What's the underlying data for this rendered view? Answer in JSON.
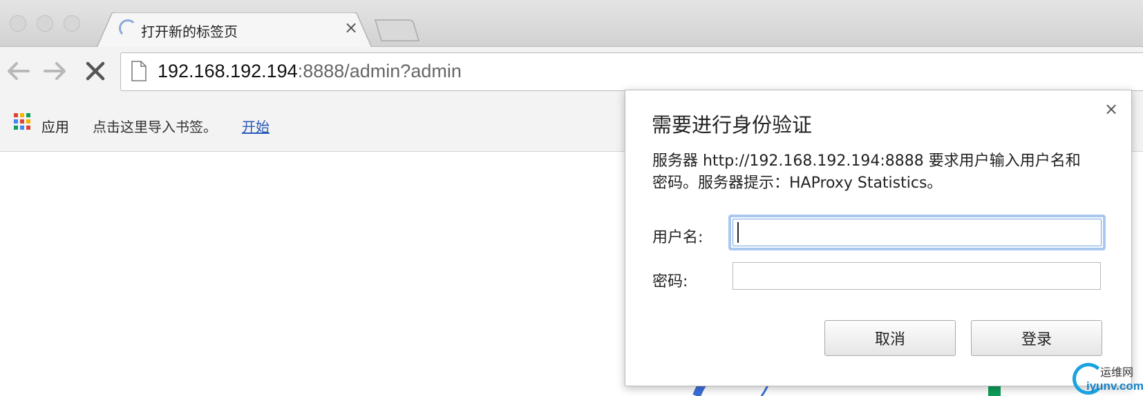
{
  "tab": {
    "title": "打开新的标签页",
    "close_glyph": "×"
  },
  "address_bar": {
    "host": "192.168.192.194",
    "rest": ":8888/admin?admin"
  },
  "bookmarks_bar": {
    "apps_label": "应用",
    "import_hint": "点击这里导入书签。",
    "start_link": "开始"
  },
  "auth_dialog": {
    "title": "需要进行身份验证",
    "close_glyph": "×",
    "message_line1": "服务器 http://192.168.192.194:8888 要求用户输入用户名和",
    "message_line2": "密码。服务器提示：HAProxy Statistics。",
    "username_label": "用户名:",
    "username_value": "",
    "password_label": "密码:",
    "password_value": "",
    "cancel_label": "取消",
    "login_label": "登录"
  },
  "watermark": {
    "cn": "运维网",
    "en": "iyunv.com"
  },
  "icons": {
    "back": "arrow-left-icon",
    "forward": "arrow-right-icon",
    "stop": "close-icon",
    "page": "page-icon",
    "apps": "apps-grid-icon",
    "spinner": "loading-spinner-icon"
  },
  "colors": {
    "link": "#2a5ab8",
    "focus_ring": "#a9c8ef",
    "apps_grid": [
      "#db4437",
      "#f4b400",
      "#0f9d58",
      "#4285f4",
      "#db4437",
      "#f4b400",
      "#0f9d58",
      "#4285f4",
      "#db4437"
    ]
  }
}
